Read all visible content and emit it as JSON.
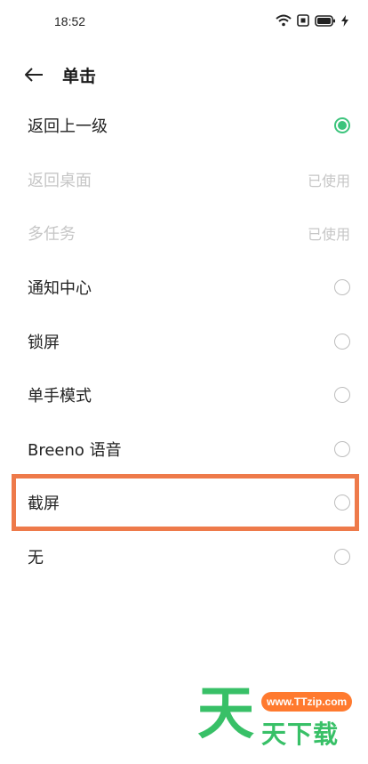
{
  "status_bar": {
    "time": "18:52",
    "icons": [
      "wifi-icon",
      "sim-icon",
      "battery-icon",
      "charging-icon"
    ]
  },
  "header": {
    "title": "单击",
    "back_icon": "back-arrow-icon"
  },
  "options": [
    {
      "label": "返回上一级",
      "state": "selected",
      "status_text": ""
    },
    {
      "label": "返回桌面",
      "state": "disabled",
      "status_text": "已使用"
    },
    {
      "label": "多任务",
      "state": "disabled",
      "status_text": "已使用"
    },
    {
      "label": "通知中心",
      "state": "unselected",
      "status_text": ""
    },
    {
      "label": "锁屏",
      "state": "unselected",
      "status_text": ""
    },
    {
      "label": "单手模式",
      "state": "unselected",
      "status_text": ""
    },
    {
      "label": "Breeno 语音",
      "state": "unselected",
      "status_text": ""
    },
    {
      "label": "截屏",
      "state": "unselected",
      "status_text": ""
    },
    {
      "label": "无",
      "state": "unselected",
      "status_text": ""
    }
  ],
  "highlight": {
    "target": "截屏",
    "color": "#ee7a4a"
  },
  "watermark": {
    "big_char": "天",
    "url": "www.TTzip.com",
    "text": "天下载"
  },
  "colors": {
    "accent": "#3cc47c",
    "disabled_text": "#c6c6c6",
    "watermark_green": "#38c067",
    "watermark_orange": "#ff7a2f"
  }
}
